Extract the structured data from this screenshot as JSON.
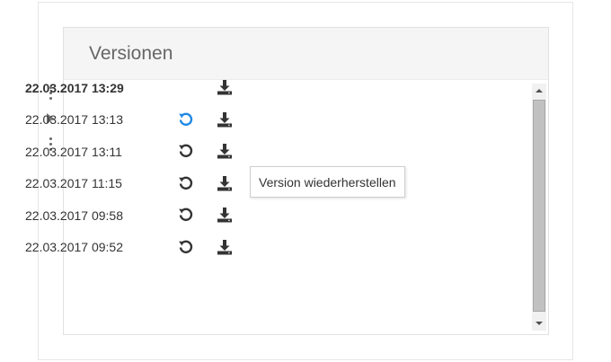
{
  "panel": {
    "title": "Versionen"
  },
  "versions": [
    {
      "date": "22.03.2017 13:29",
      "current": true,
      "restore_icon": null,
      "download_icon": "download-icon"
    },
    {
      "date": "22.03.2017 13:13",
      "current": false,
      "restore_icon": "restore-icon",
      "restore_color": "#1e88e5",
      "download_icon": "download-icon"
    },
    {
      "date": "22.03.2017 13:11",
      "current": false,
      "restore_icon": "restore-icon",
      "restore_color": "#333333",
      "download_icon": "download-icon"
    },
    {
      "date": "22.03.2017 11:15",
      "current": false,
      "restore_icon": "restore-icon",
      "restore_color": "#333333",
      "download_icon": "download-icon"
    },
    {
      "date": "22.03.2017 09:58",
      "current": false,
      "restore_icon": "restore-icon",
      "restore_color": "#333333",
      "download_icon": "download-icon"
    },
    {
      "date": "22.03.2017 09:52",
      "current": false,
      "restore_icon": "restore-icon",
      "restore_color": "#333333",
      "download_icon": "download-icon"
    }
  ],
  "tooltip": {
    "text": "Version wiederherstellen"
  },
  "colors": {
    "accent": "#1e88e5",
    "icon": "#333333"
  }
}
